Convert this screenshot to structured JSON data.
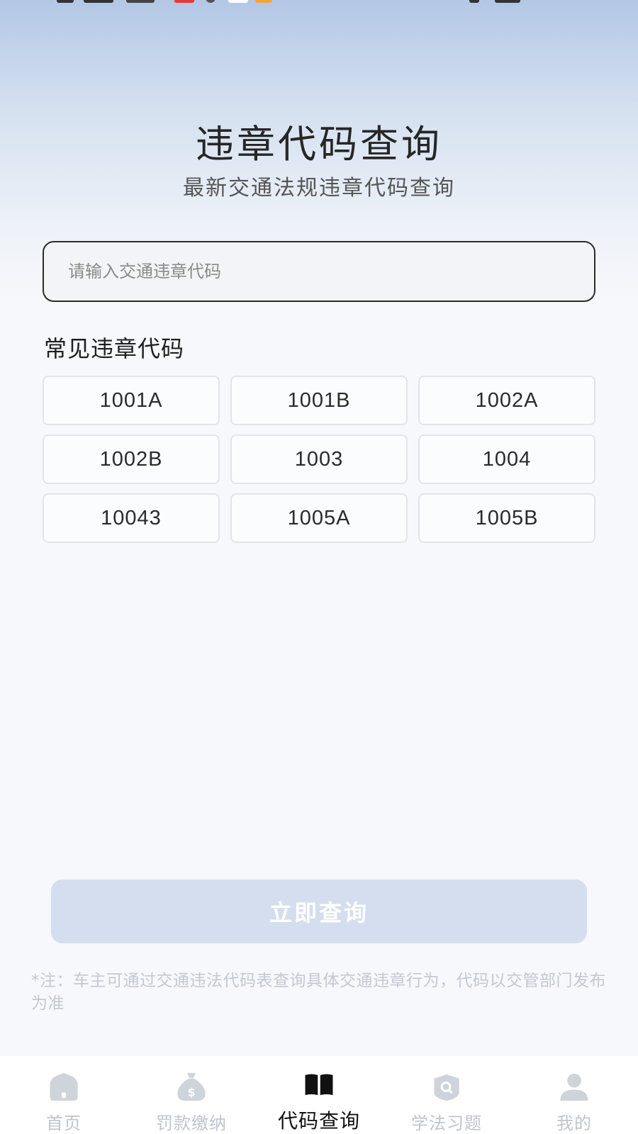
{
  "header": {
    "title": "违章代码查询",
    "subtitle": "最新交通法规违章代码查询"
  },
  "search": {
    "placeholder": "请输入交通违章代码",
    "value": ""
  },
  "common_codes": {
    "title": "常见违章代码",
    "items": [
      "1001A",
      "1001B",
      "1002A",
      "1002B",
      "1003",
      "1004",
      "10043",
      "1005A",
      "1005B"
    ]
  },
  "query_button": {
    "label": "立即查询"
  },
  "note": {
    "text": "*注：车主可通过交通违法代码表查询具体交通违章行为，代码以交管部门发布为准"
  },
  "tabbar": {
    "tabs": [
      {
        "label": "首页",
        "icon": "home-icon",
        "active": false
      },
      {
        "label": "罚款缴纳",
        "icon": "money-bag-icon",
        "active": false
      },
      {
        "label": "代码查询",
        "icon": "book-icon",
        "active": true
      },
      {
        "label": "学法习题",
        "icon": "search-badge-icon",
        "active": false
      },
      {
        "label": "我的",
        "icon": "user-icon",
        "active": false
      }
    ]
  },
  "colors": {
    "accent": "#111111",
    "inactive": "#c0c4cc",
    "button_disabled": "#d4deef"
  }
}
